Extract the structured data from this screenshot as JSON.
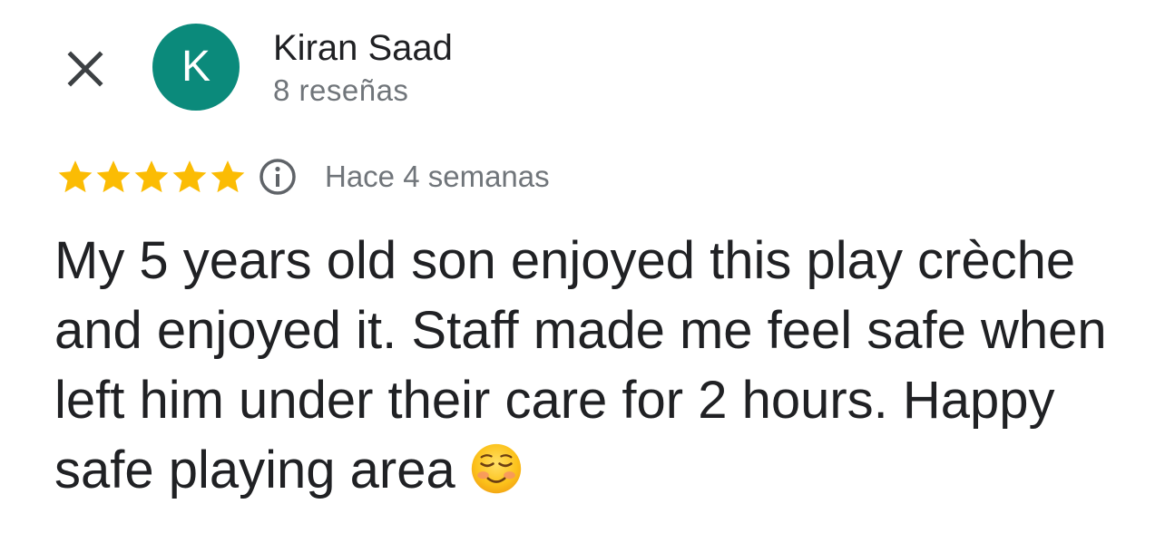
{
  "header": {
    "close_icon": "close-icon",
    "author": {
      "initial": "K",
      "avatar_color": "#0b8a7b",
      "name": "Kiran Saad",
      "review_count": "8 reseñas"
    }
  },
  "review": {
    "rating": 5,
    "rating_max": 5,
    "star_color": "#fbbc04",
    "info_icon": "info-icon",
    "date": "Hace 4 semanas",
    "text": "My 5 years old son enjoyed this play crèche and enjoyed it. Staff made me feel safe when  left him under their care for 2 hours. Happy safe playing area ",
    "emoji": "smiling-face-icon"
  }
}
